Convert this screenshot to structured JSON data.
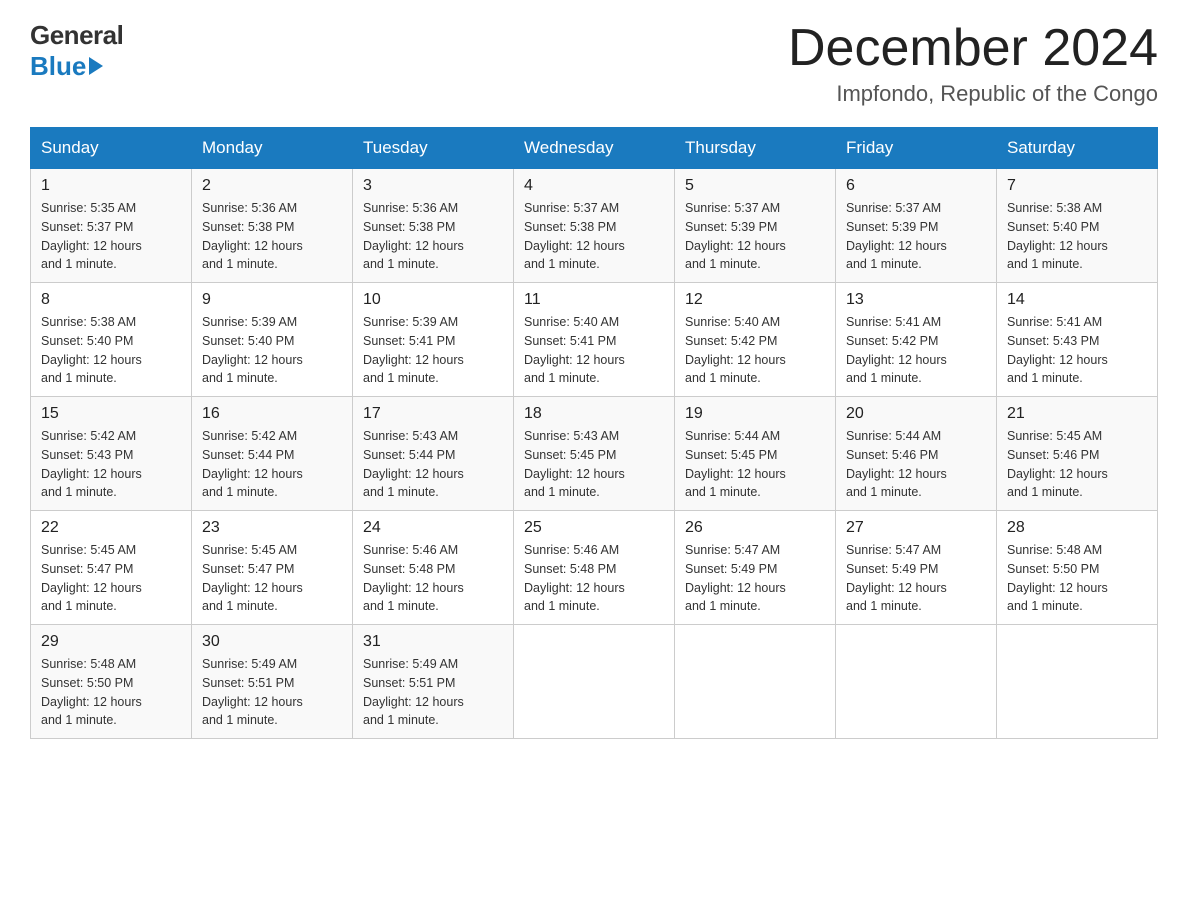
{
  "header": {
    "logo_line1": "General",
    "logo_line2": "Blue",
    "month_title": "December 2024",
    "location": "Impfondo, Republic of the Congo"
  },
  "days_of_week": [
    "Sunday",
    "Monday",
    "Tuesday",
    "Wednesday",
    "Thursday",
    "Friday",
    "Saturday"
  ],
  "weeks": [
    [
      {
        "day": "1",
        "sunrise": "5:35 AM",
        "sunset": "5:37 PM",
        "daylight": "12 hours and 1 minute."
      },
      {
        "day": "2",
        "sunrise": "5:36 AM",
        "sunset": "5:38 PM",
        "daylight": "12 hours and 1 minute."
      },
      {
        "day": "3",
        "sunrise": "5:36 AM",
        "sunset": "5:38 PM",
        "daylight": "12 hours and 1 minute."
      },
      {
        "day": "4",
        "sunrise": "5:37 AM",
        "sunset": "5:38 PM",
        "daylight": "12 hours and 1 minute."
      },
      {
        "day": "5",
        "sunrise": "5:37 AM",
        "sunset": "5:39 PM",
        "daylight": "12 hours and 1 minute."
      },
      {
        "day": "6",
        "sunrise": "5:37 AM",
        "sunset": "5:39 PM",
        "daylight": "12 hours and 1 minute."
      },
      {
        "day": "7",
        "sunrise": "5:38 AM",
        "sunset": "5:40 PM",
        "daylight": "12 hours and 1 minute."
      }
    ],
    [
      {
        "day": "8",
        "sunrise": "5:38 AM",
        "sunset": "5:40 PM",
        "daylight": "12 hours and 1 minute."
      },
      {
        "day": "9",
        "sunrise": "5:39 AM",
        "sunset": "5:40 PM",
        "daylight": "12 hours and 1 minute."
      },
      {
        "day": "10",
        "sunrise": "5:39 AM",
        "sunset": "5:41 PM",
        "daylight": "12 hours and 1 minute."
      },
      {
        "day": "11",
        "sunrise": "5:40 AM",
        "sunset": "5:41 PM",
        "daylight": "12 hours and 1 minute."
      },
      {
        "day": "12",
        "sunrise": "5:40 AM",
        "sunset": "5:42 PM",
        "daylight": "12 hours and 1 minute."
      },
      {
        "day": "13",
        "sunrise": "5:41 AM",
        "sunset": "5:42 PM",
        "daylight": "12 hours and 1 minute."
      },
      {
        "day": "14",
        "sunrise": "5:41 AM",
        "sunset": "5:43 PM",
        "daylight": "12 hours and 1 minute."
      }
    ],
    [
      {
        "day": "15",
        "sunrise": "5:42 AM",
        "sunset": "5:43 PM",
        "daylight": "12 hours and 1 minute."
      },
      {
        "day": "16",
        "sunrise": "5:42 AM",
        "sunset": "5:44 PM",
        "daylight": "12 hours and 1 minute."
      },
      {
        "day": "17",
        "sunrise": "5:43 AM",
        "sunset": "5:44 PM",
        "daylight": "12 hours and 1 minute."
      },
      {
        "day": "18",
        "sunrise": "5:43 AM",
        "sunset": "5:45 PM",
        "daylight": "12 hours and 1 minute."
      },
      {
        "day": "19",
        "sunrise": "5:44 AM",
        "sunset": "5:45 PM",
        "daylight": "12 hours and 1 minute."
      },
      {
        "day": "20",
        "sunrise": "5:44 AM",
        "sunset": "5:46 PM",
        "daylight": "12 hours and 1 minute."
      },
      {
        "day": "21",
        "sunrise": "5:45 AM",
        "sunset": "5:46 PM",
        "daylight": "12 hours and 1 minute."
      }
    ],
    [
      {
        "day": "22",
        "sunrise": "5:45 AM",
        "sunset": "5:47 PM",
        "daylight": "12 hours and 1 minute."
      },
      {
        "day": "23",
        "sunrise": "5:45 AM",
        "sunset": "5:47 PM",
        "daylight": "12 hours and 1 minute."
      },
      {
        "day": "24",
        "sunrise": "5:46 AM",
        "sunset": "5:48 PM",
        "daylight": "12 hours and 1 minute."
      },
      {
        "day": "25",
        "sunrise": "5:46 AM",
        "sunset": "5:48 PM",
        "daylight": "12 hours and 1 minute."
      },
      {
        "day": "26",
        "sunrise": "5:47 AM",
        "sunset": "5:49 PM",
        "daylight": "12 hours and 1 minute."
      },
      {
        "day": "27",
        "sunrise": "5:47 AM",
        "sunset": "5:49 PM",
        "daylight": "12 hours and 1 minute."
      },
      {
        "day": "28",
        "sunrise": "5:48 AM",
        "sunset": "5:50 PM",
        "daylight": "12 hours and 1 minute."
      }
    ],
    [
      {
        "day": "29",
        "sunrise": "5:48 AM",
        "sunset": "5:50 PM",
        "daylight": "12 hours and 1 minute."
      },
      {
        "day": "30",
        "sunrise": "5:49 AM",
        "sunset": "5:51 PM",
        "daylight": "12 hours and 1 minute."
      },
      {
        "day": "31",
        "sunrise": "5:49 AM",
        "sunset": "5:51 PM",
        "daylight": "12 hours and 1 minute."
      },
      null,
      null,
      null,
      null
    ]
  ],
  "labels": {
    "sunrise": "Sunrise:",
    "sunset": "Sunset:",
    "daylight": "Daylight:"
  }
}
